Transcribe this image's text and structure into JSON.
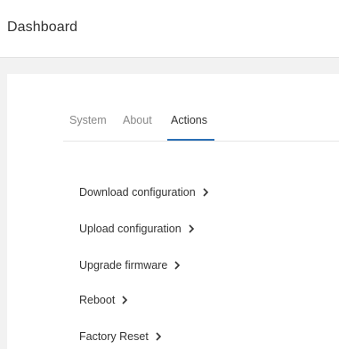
{
  "header": {
    "title": "Dashboard"
  },
  "tabs": [
    {
      "label": "System",
      "active": false
    },
    {
      "label": "About",
      "active": false
    },
    {
      "label": "Actions",
      "active": true
    }
  ],
  "actions": [
    {
      "label": "Download configuration",
      "icon": "chevron-right-icon"
    },
    {
      "label": "Upload configuration",
      "icon": "chevron-right-icon"
    },
    {
      "label": "Upgrade firmware",
      "icon": "chevron-right-icon"
    },
    {
      "label": "Reboot",
      "icon": "chevron-right-icon"
    },
    {
      "label": "Factory Reset",
      "icon": "chevron-right-icon"
    }
  ],
  "colors": {
    "background": "#f2f2f2",
    "surface": "#ffffff",
    "text": "#333333",
    "muted_text": "#888888",
    "accent": "#2a6fb5"
  }
}
